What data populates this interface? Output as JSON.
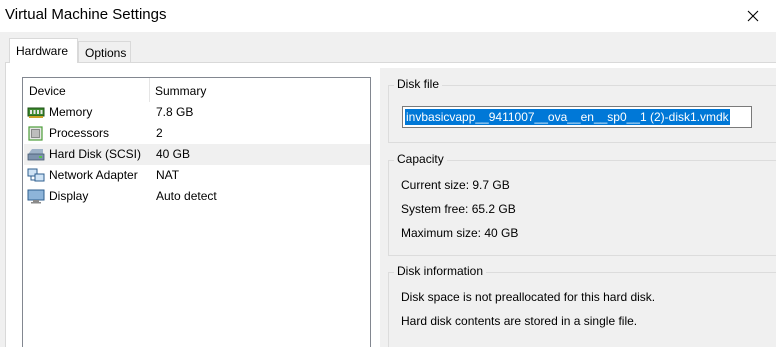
{
  "window": {
    "title": "Virtual Machine Settings"
  },
  "tabs": [
    {
      "label": "Hardware",
      "active": true
    },
    {
      "label": "Options",
      "active": false
    }
  ],
  "device_list": {
    "columns": {
      "device": "Device",
      "summary": "Summary"
    },
    "rows": [
      {
        "icon": "memory-icon",
        "name": "Memory",
        "summary": "7.8 GB",
        "selected": false
      },
      {
        "icon": "processor-icon",
        "name": "Processors",
        "summary": "2",
        "selected": false
      },
      {
        "icon": "hard-disk-icon",
        "name": "Hard Disk (SCSI)",
        "summary": "40 GB",
        "selected": true
      },
      {
        "icon": "network-adapter-icon",
        "name": "Network Adapter",
        "summary": "NAT",
        "selected": false
      },
      {
        "icon": "display-icon",
        "name": "Display",
        "summary": "Auto detect",
        "selected": false
      }
    ]
  },
  "disk_file": {
    "title": "Disk file",
    "value": "invbasicvapp__9411007__ova__en__sp0__1 (2)-disk1.vmdk"
  },
  "capacity": {
    "title": "Capacity",
    "current_size": "Current size: 9.7 GB",
    "system_free": "System free: 65.2 GB",
    "maximum_size": "Maximum size: 40 GB"
  },
  "disk_information": {
    "title": "Disk information",
    "line1": "Disk space is not preallocated for this hard disk.",
    "line2": "Hard disk contents are stored in a single file."
  },
  "colors": {
    "selection": "#0078d7",
    "panel": "#f0f0f0"
  }
}
